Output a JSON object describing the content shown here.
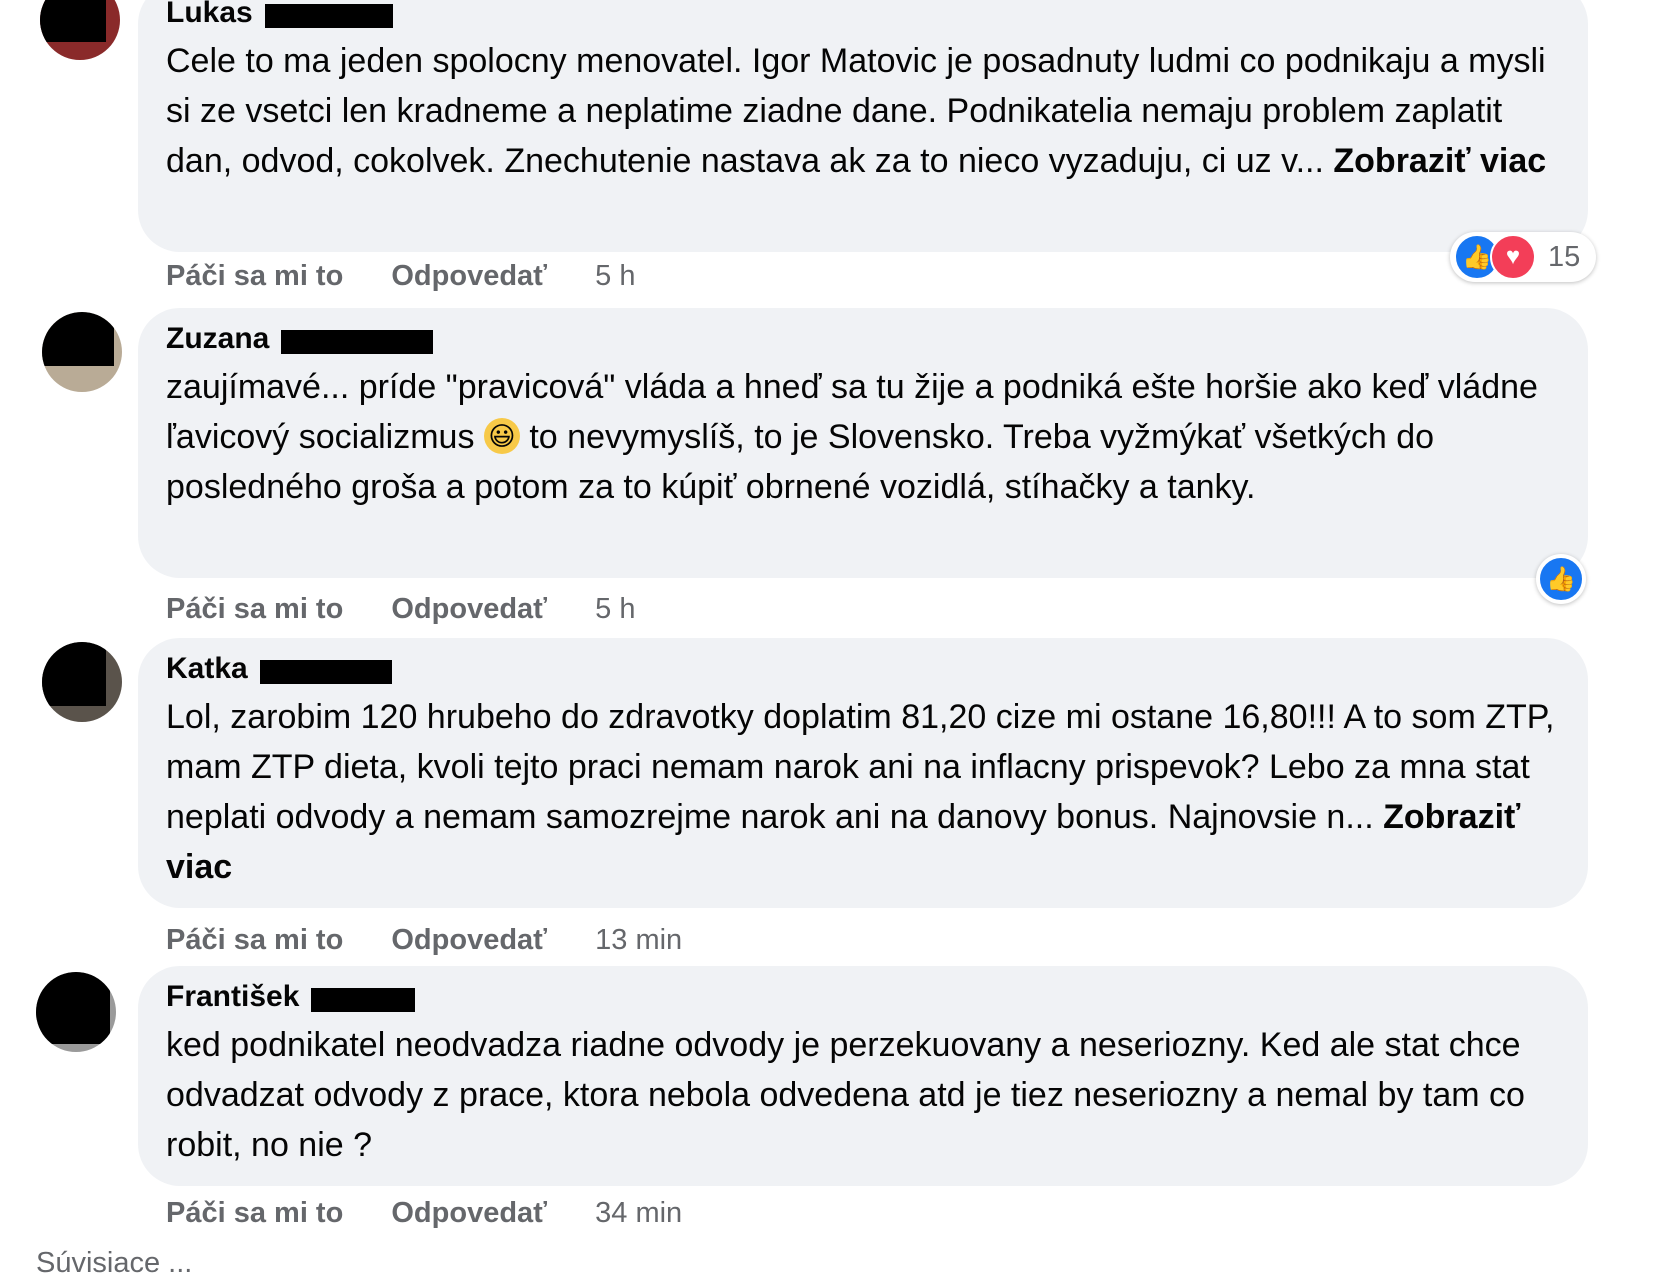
{
  "comments": [
    {
      "author": "Lukas",
      "text": "Cele to ma jeden spolocny menovatel. Igor Matovic je posadnuty ludmi co podnikaju a mysli si ze vsetci len kradneme a neplatime ziadne dane. Podnikatelia nemaju problem zaplatit dan, odvod, cokolvek. Znechutenie nastava ak za to nieco vyzaduju, ci uz v...",
      "see_more": "Zobraziť viac",
      "like_label": "Páči sa mi to",
      "reply_label": "Odpovedať",
      "time": "5 h",
      "reaction_count": "15",
      "reaction_icons": [
        "like-icon",
        "love-icon"
      ]
    },
    {
      "author": "Zuzana",
      "text_before_emoji": "zaujímavé... príde \"pravicová\" vláda a hneď sa tu žije a podniká ešte horšie ako keď vládne ľavicový socializmus",
      "emoji": "😃",
      "text_after_emoji": " to nevymyslíš, to je Slovensko. Treba vyžmýkať všetkých do posledného groša a potom za to kúpiť obrnené vozidlá, stíhačky a tanky.",
      "like_label": "Páči sa mi to",
      "reply_label": "Odpovedať",
      "time": "5 h",
      "reaction_icons": [
        "like-icon"
      ]
    },
    {
      "author": "Katka",
      "text": "Lol, zarobim 120 hrubeho do zdravotky doplatim 81,20 cize mi ostane 16,80!!! A to som ZTP, mam ZTP dieta, kvoli tejto praci nemam narok ani na inflacny prispevok? Lebo za mna stat neplati odvody a nemam samozrejme narok ani na danovy bonus. Najnovsie n...",
      "see_more": "Zobraziť viac",
      "like_label": "Páči sa mi to",
      "reply_label": "Odpovedať",
      "time": "13 min"
    },
    {
      "author": "František",
      "text": "ked podnikatel neodvadza riadne odvody je perzekuovany a neseriozny. Ked ale stat chce odvadzat odvody z prace, ktora nebola odvedena atd je tiez neseriozny a nemal by tam co robit, no nie ?",
      "like_label": "Páči sa mi to",
      "reply_label": "Odpovedať",
      "time": "34 min"
    }
  ],
  "footer_text": "Súvisiace ...",
  "colors": {
    "bubble": "#f0f2f5",
    "meta_text": "#65676b",
    "like": "#1877f2",
    "love": "#f33e58",
    "redaction": "#000000"
  }
}
